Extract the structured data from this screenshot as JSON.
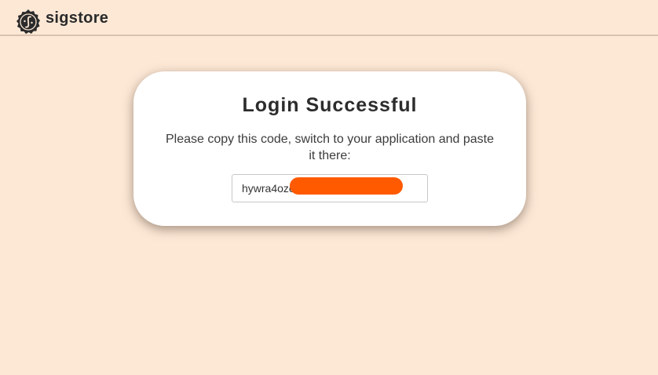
{
  "header": {
    "logo_text": "sigstore",
    "logo_icon": "sigstore-logo-icon"
  },
  "card": {
    "title": "Login Successful",
    "message": "Please copy this code, switch to your application and paste it there:",
    "code_value": "hywra4oze"
  },
  "colors": {
    "page_background": "#fde8d6",
    "card_background": "#ffffff",
    "redaction": "#ff5a00"
  }
}
